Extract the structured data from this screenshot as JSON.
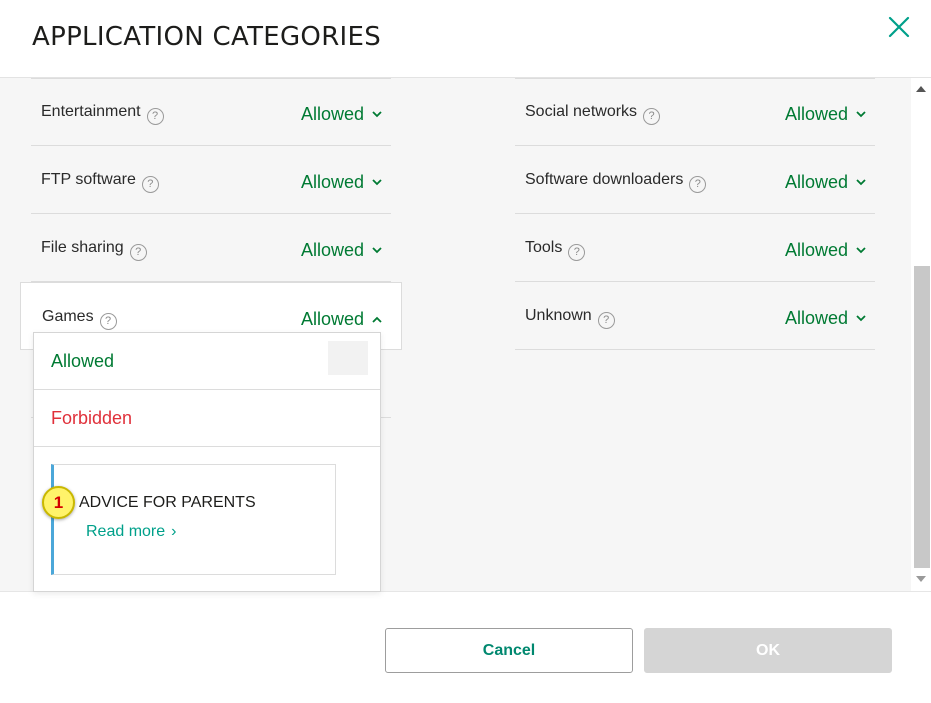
{
  "dialog": {
    "title": "APPLICATION CATEGORIES",
    "close_icon": "close-icon"
  },
  "categories_left": [
    {
      "label": "Entertainment",
      "status": "Allowed"
    },
    {
      "label": "FTP software",
      "status": "Allowed"
    },
    {
      "label": "File sharing",
      "status": "Allowed"
    },
    {
      "label": "Games",
      "status": "Allowed",
      "expanded": true
    }
  ],
  "categories_right": [
    {
      "label": "Social networks",
      "status": "Allowed"
    },
    {
      "label": "Software downloaders",
      "status": "Allowed"
    },
    {
      "label": "Tools",
      "status": "Allowed"
    },
    {
      "label": "Unknown",
      "status": "Allowed"
    }
  ],
  "help_icon_text": "?",
  "dropdown": {
    "options": [
      "Allowed",
      "Forbidden"
    ],
    "advice": {
      "badge": "1",
      "title": "ADVICE FOR PARENTS",
      "link": "Read more",
      "link_arrow": "›"
    }
  },
  "footer": {
    "cancel_label": "Cancel",
    "ok_label": "OK"
  },
  "colors": {
    "allowed": "#007a33",
    "forbidden": "#e0303a",
    "accent": "#00a08a",
    "advice_bar": "#4ba7d9"
  }
}
